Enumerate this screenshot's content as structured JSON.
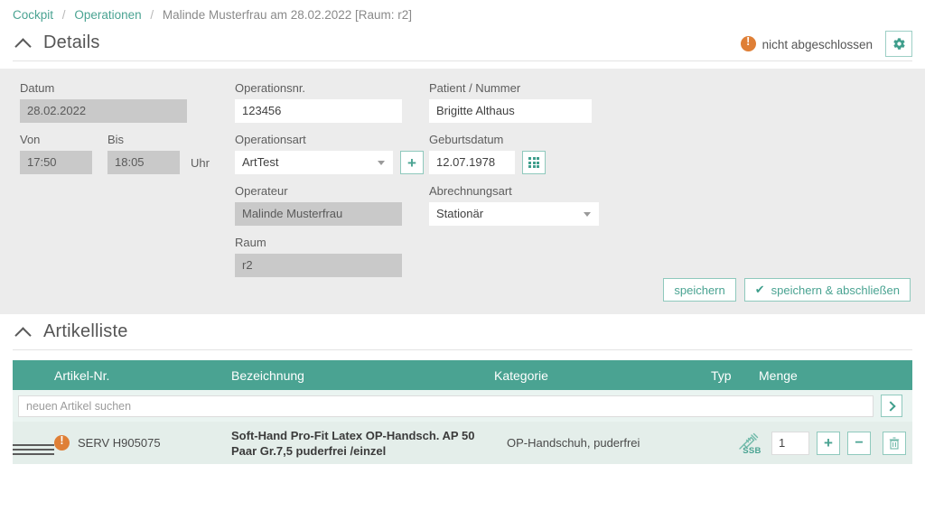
{
  "breadcrumb": {
    "items": [
      {
        "label": "Cockpit",
        "link": true
      },
      {
        "label": "Operationen",
        "link": true
      },
      {
        "label": "Malinde Musterfrau am 28.02.2022 [Raum: r2]",
        "link": false
      }
    ],
    "separator": "/"
  },
  "details": {
    "title": "Details",
    "status_label": "nicht abgeschlossen",
    "status_icon": "alert-circle-icon",
    "settings_icon": "gear-icon",
    "fields": {
      "datum_label": "Datum",
      "datum_value": "28.02.2022",
      "von_label": "Von",
      "von_value": "17:50",
      "bis_label": "Bis",
      "bis_value": "18:05",
      "uhr_label": "Uhr",
      "operationsnr_label": "Operationsnr.",
      "operationsnr_value": "123456",
      "operationsart_label": "Operationsart",
      "operationsart_value": "ArtTest",
      "add_art_icon": "plus-icon",
      "operateur_label": "Operateur",
      "operateur_value": "Malinde Musterfrau",
      "raum_label": "Raum",
      "raum_value": "r2",
      "patient_label": "Patient / Nummer",
      "patient_value": "Brigitte Althaus",
      "geburtsdatum_label": "Geburtsdatum",
      "geburtsdatum_value": "12.07.1978",
      "calendar_icon": "calendar-icon",
      "abrechnungsart_label": "Abrechnungsart",
      "abrechnungsart_value": "Stationär"
    },
    "buttons": {
      "save": "speichern",
      "save_complete": "speichern & abschließen",
      "save_complete_icon": "check-icon"
    }
  },
  "articles": {
    "title": "Artikelliste",
    "columns": {
      "artikel_nr": "Artikel-Nr.",
      "bezeichnung": "Bezeichnung",
      "kategorie": "Kategorie",
      "typ": "Typ",
      "menge": "Menge"
    },
    "search": {
      "placeholder": "neuen Artikel suchen",
      "value": "",
      "submit_icon": "chevron-right-icon"
    },
    "rows": [
      {
        "handle_icon": "drag-handle-icon",
        "status_icon": "alert-circle-icon",
        "artikel_nr": "SERV H905075",
        "bezeichnung": "Soft-Hand Pro-Fit Latex OP-Handsch. AP 50 Paar Gr.7,5 puderfrei /einzel",
        "kategorie": "OP-Handschuh, puderfrei",
        "typ_icon": "syringe-icon",
        "typ_label": "SSB",
        "menge": "1",
        "increase_icon": "plus-icon",
        "decrease_icon": "minus-icon",
        "delete_icon": "trash-icon"
      }
    ]
  },
  "colors": {
    "accent_teal": "#4aa392",
    "accent_teal_dark": "#3f9e8c",
    "alert_orange": "#df7f36",
    "panel_gray": "#ececec",
    "readonly_gray": "#c9c9c9",
    "row_green": "#e4eeea",
    "search_green": "#eaf4f1"
  }
}
